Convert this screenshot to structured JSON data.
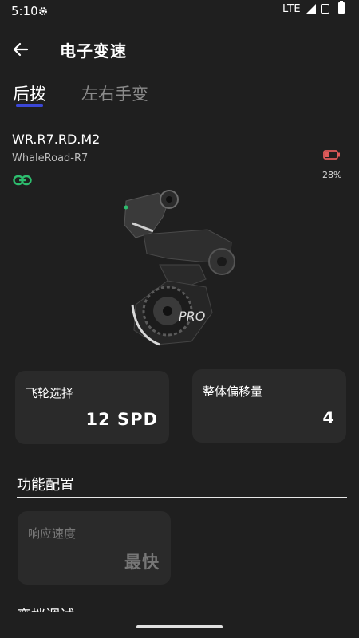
{
  "status_bar": {
    "time": "5:10",
    "network": "LTE"
  },
  "app_bar": {
    "title": "电子变速"
  },
  "tabs": [
    {
      "label": "后拨",
      "active": true
    },
    {
      "label": "左右手变",
      "active": false
    }
  ],
  "device": {
    "model": "WR.R7.RD.M2",
    "name": "WhaleRoad-R7",
    "battery_percent": "28%"
  },
  "cards": {
    "flywheel": {
      "label": "飞轮选择",
      "value": "12 SPD"
    },
    "offset": {
      "label": "整体偏移量",
      "value": "4"
    }
  },
  "function_section": {
    "title": "功能配置",
    "response_speed": {
      "label": "响应速度",
      "value": "最快"
    },
    "next_section_partial": "变挡调试"
  },
  "colors": {
    "background": "#1f1f1f",
    "card": "#2a2a2a",
    "tab_indicator": "#3b47d6",
    "link_green": "#2dbd6e",
    "battery_red": "#e05a5a"
  },
  "icons": {
    "back": "arrow-left-icon",
    "status_gear": "gear-icon",
    "link": "link-icon",
    "battery": "battery-low-icon"
  }
}
